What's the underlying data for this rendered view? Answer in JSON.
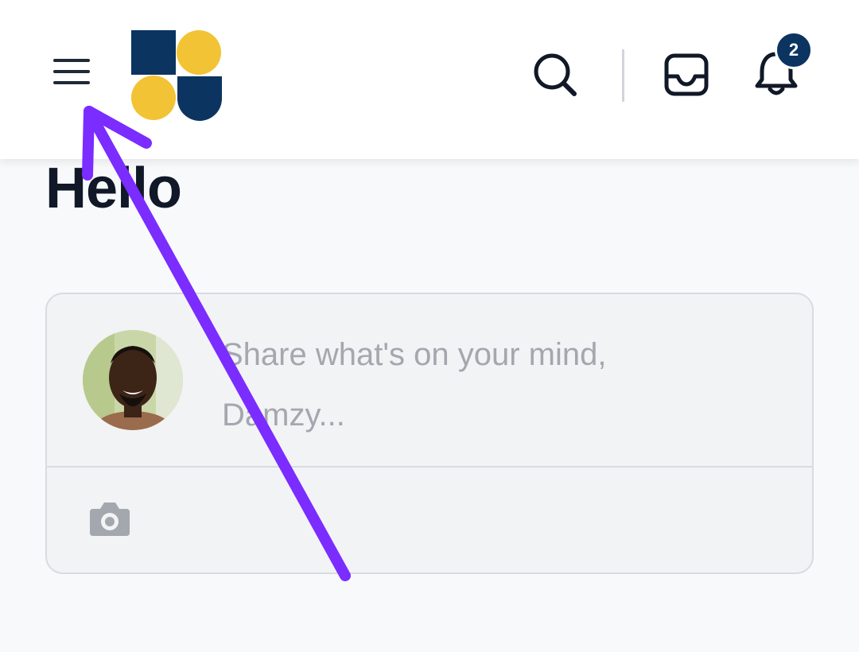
{
  "header": {
    "menu_icon": "hamburger-menu-icon",
    "logo_icon": "app-logo-icon",
    "search_icon": "search-icon",
    "inbox_icon": "inbox-tray-icon",
    "bell_icon": "bell-icon",
    "notification_count": "2"
  },
  "main": {
    "title": "Hello",
    "composer": {
      "placeholder": "Share what's on your mind, Damzy...",
      "avatar_icon": "user-avatar",
      "camera_icon": "camera-icon"
    }
  },
  "colors": {
    "navy": "#0b3461",
    "yellow": "#f2c335",
    "annotation_purple": "#7b2cff",
    "background": "#f8f9fb"
  }
}
